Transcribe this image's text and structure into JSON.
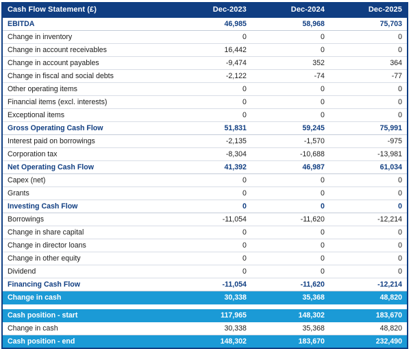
{
  "table": {
    "title": "Cash Flow Statement (£)",
    "columns": [
      "Cash Flow Statement (£)",
      "Dec-2023",
      "Dec-2024",
      "Dec-2025"
    ],
    "colors": {
      "header_bg": "#103E82",
      "header_text": "#FFFFFF",
      "subtotal_text": "#103E82",
      "highlight_bg": "#1B9AD6",
      "highlight_text": "#FFFFFF",
      "body_bg": "#FFFFFF",
      "body_text": "#1A1A1A",
      "grid_line": "#D8DDE6"
    },
    "rows": [
      {
        "style": "subtotal",
        "label": "EBITDA",
        "values": [
          "46,985",
          "58,968",
          "75,703"
        ]
      },
      {
        "style": "normal",
        "label": "Change in inventory",
        "values": [
          "0",
          "0",
          "0"
        ]
      },
      {
        "style": "normal",
        "label": "Change in account receivables",
        "values": [
          "16,442",
          "0",
          "0"
        ]
      },
      {
        "style": "normal",
        "label": "Change in account payables",
        "values": [
          "-9,474",
          "352",
          "364"
        ]
      },
      {
        "style": "normal",
        "label": "Change in fiscal and social debts",
        "values": [
          "-2,122",
          "-74",
          "-77"
        ]
      },
      {
        "style": "normal",
        "label": "Other operating items",
        "values": [
          "0",
          "0",
          "0"
        ]
      },
      {
        "style": "normal",
        "label": "Financial items (excl. interests)",
        "values": [
          "0",
          "0",
          "0"
        ]
      },
      {
        "style": "normal",
        "label": "Exceptional items",
        "values": [
          "0",
          "0",
          "0"
        ]
      },
      {
        "style": "subtotal",
        "label": "Gross Operating Cash Flow",
        "values": [
          "51,831",
          "59,245",
          "75,991"
        ]
      },
      {
        "style": "normal",
        "label": "Interest paid on borrowings",
        "values": [
          "-2,135",
          "-1,570",
          "-975"
        ]
      },
      {
        "style": "normal",
        "label": "Corporation tax",
        "values": [
          "-8,304",
          "-10,688",
          "-13,981"
        ]
      },
      {
        "style": "subtotal",
        "label": "Net Operating Cash Flow",
        "values": [
          "41,392",
          "46,987",
          "61,034"
        ]
      },
      {
        "style": "normal",
        "label": "Capex (net)",
        "values": [
          "0",
          "0",
          "0"
        ]
      },
      {
        "style": "normal",
        "label": "Grants",
        "values": [
          "0",
          "0",
          "0"
        ]
      },
      {
        "style": "subtotal",
        "label": "Investing Cash Flow",
        "values": [
          "0",
          "0",
          "0"
        ]
      },
      {
        "style": "normal",
        "label": "Borrowings",
        "values": [
          "-11,054",
          "-11,620",
          "-12,214"
        ]
      },
      {
        "style": "normal",
        "label": "Change in share capital",
        "values": [
          "0",
          "0",
          "0"
        ]
      },
      {
        "style": "normal",
        "label": "Change in director loans",
        "values": [
          "0",
          "0",
          "0"
        ]
      },
      {
        "style": "normal",
        "label": "Change in other equity",
        "values": [
          "0",
          "0",
          "0"
        ]
      },
      {
        "style": "normal",
        "label": "Dividend",
        "values": [
          "0",
          "0",
          "0"
        ]
      },
      {
        "style": "subtotal",
        "label": "Financing Cash Flow",
        "values": [
          "-11,054",
          "-11,620",
          "-12,214"
        ]
      },
      {
        "style": "highlight",
        "label": "Change in cash",
        "values": [
          "30,338",
          "35,368",
          "48,820"
        ]
      },
      {
        "style": "spacer",
        "label": "",
        "values": [
          "",
          "",
          ""
        ]
      },
      {
        "style": "highlight",
        "label": "Cash position - start",
        "values": [
          "117,965",
          "148,302",
          "183,670"
        ]
      },
      {
        "style": "normal",
        "label": "Change in cash",
        "values": [
          "30,338",
          "35,368",
          "48,820"
        ]
      },
      {
        "style": "highlight",
        "label": "Cash position - end",
        "values": [
          "148,302",
          "183,670",
          "232,490"
        ]
      }
    ]
  }
}
